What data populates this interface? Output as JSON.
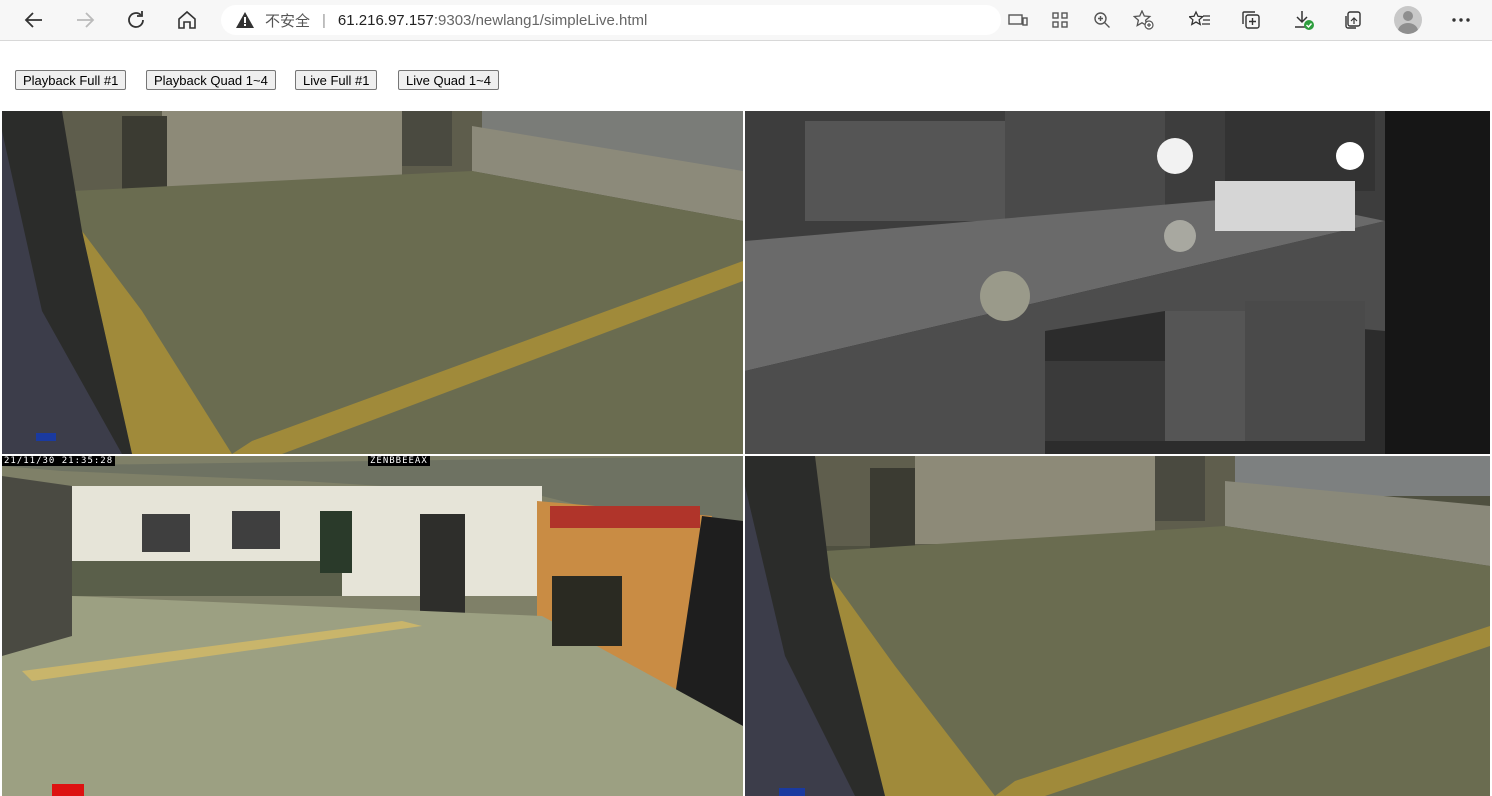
{
  "browser": {
    "security_label": "不安全",
    "url_host": "61.216.97.157",
    "url_path": ":9303/newlang1/simpleLive.html"
  },
  "buttons": {
    "playback_full": "Playback Full #1",
    "playback_quad": "Playback Quad 1~4",
    "live_full": "Live Full #1",
    "live_quad": "Live Quad 1~4"
  },
  "cameras": {
    "cam3_timestamp": "21/11/30 21:35:28",
    "cam3_label": "ZENBBEEAX"
  },
  "icons": {
    "back": "back-arrow-icon",
    "forward": "forward-arrow-icon",
    "refresh": "refresh-icon",
    "home": "home-icon",
    "warning": "warning-icon",
    "cast": "cast-icon",
    "apps": "apps-icon",
    "zoom": "zoom-icon",
    "favorite_add": "favorite-add-icon",
    "favorites": "favorites-icon",
    "collections": "collections-icon",
    "downloads": "downloads-icon",
    "share": "share-icon",
    "profile": "profile-icon",
    "more": "more-icon"
  }
}
